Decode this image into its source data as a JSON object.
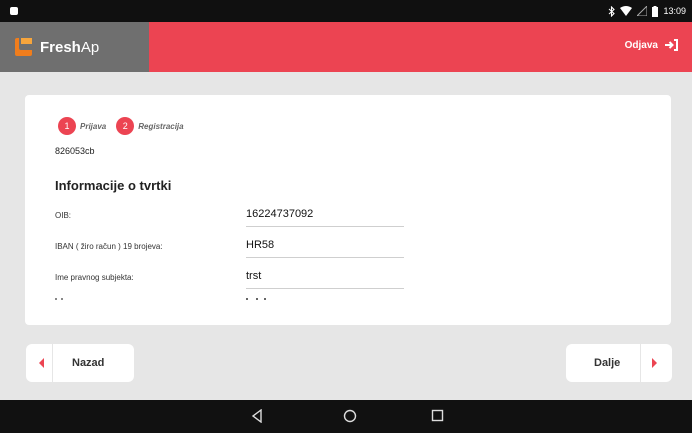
{
  "status_bar": {
    "time": "13:09"
  },
  "app_bar": {
    "brand_prefix": "Fresh",
    "brand_suffix": "Ap",
    "logout_label": "Odjava"
  },
  "steps": [
    {
      "number": "1",
      "label": "Prijava"
    },
    {
      "number": "2",
      "label": "Registracija"
    }
  ],
  "code": "826053cb",
  "section_title": "Informacije o tvrtki",
  "fields": [
    {
      "label": "OIB:",
      "value": "16224737092"
    },
    {
      "label": "IBAN ( žiro račun ) 19 brojeva:",
      "value": "HR58"
    },
    {
      "label": "Ime pravnog subjekta:",
      "value": "trst"
    }
  ],
  "buttons": {
    "back": "Nazad",
    "next": "Dalje"
  },
  "colors": {
    "accent": "#ec4452",
    "brand_bg": "#6f6f6f",
    "logo": "#f07d1c"
  }
}
